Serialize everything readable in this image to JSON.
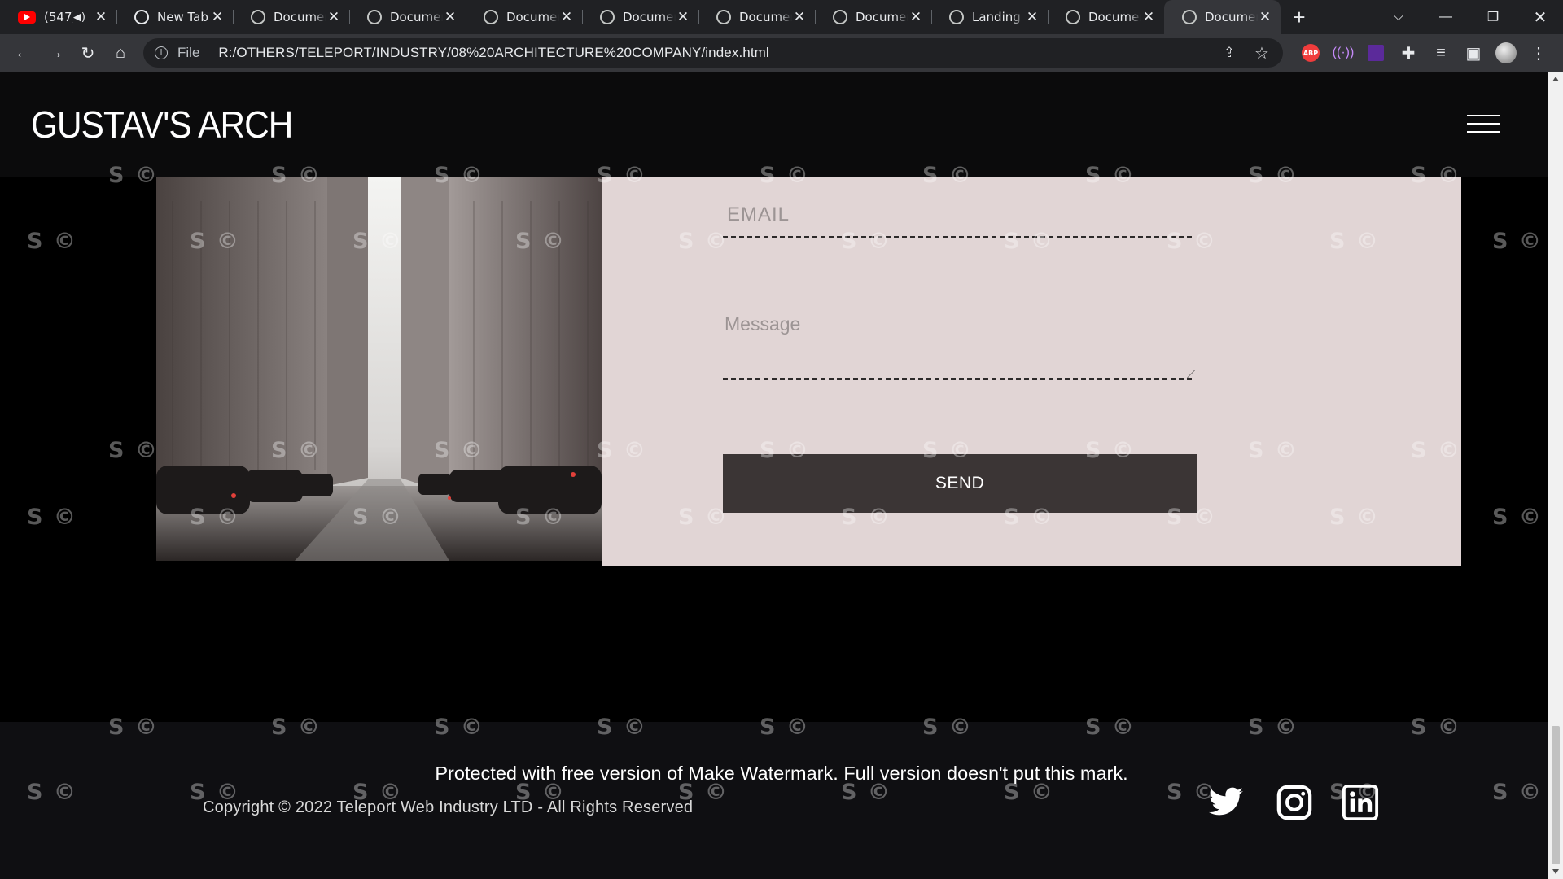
{
  "browser": {
    "tabs": [
      {
        "title": "(547)",
        "icon": "youtube-icon",
        "audio": true
      },
      {
        "title": "New Tab",
        "icon": "chrome-icon"
      },
      {
        "title": "Document",
        "icon": "globe-icon"
      },
      {
        "title": "Document",
        "icon": "globe-icon"
      },
      {
        "title": "Document",
        "icon": "globe-icon"
      },
      {
        "title": "Document",
        "icon": "globe-icon"
      },
      {
        "title": "Document",
        "icon": "globe-icon"
      },
      {
        "title": "Document",
        "icon": "globe-icon"
      },
      {
        "title": "Landing Page",
        "icon": "globe-icon"
      },
      {
        "title": "Document",
        "icon": "globe-icon"
      },
      {
        "title": "Document",
        "icon": "globe-icon",
        "active": true
      }
    ],
    "address": {
      "scheme_label": "File",
      "url": "R:/OTHERS/TELEPORT/INDUSTRY/08%20ARCHITECTURE%20COMPANY/index.html"
    },
    "extensions": {
      "abp_label": "ABP"
    }
  },
  "site": {
    "logo": "GUSTAV'S ARCH",
    "form": {
      "email_placeholder": "EMAIL",
      "message_placeholder": "Message",
      "send_label": "SEND"
    },
    "footer": {
      "copyright": "Copyright © 2022 Teleport Web Industry LTD - All Rights Reserved",
      "social": [
        "twitter-icon",
        "instagram-icon",
        "linkedin-icon"
      ]
    },
    "watermark": {
      "mark": "S ©",
      "notice": "Protected with free version of Make Watermark. Full version doesn't put this mark."
    }
  },
  "colors": {
    "form_bg": "#e1d5d5",
    "send_bg": "#3b3535",
    "header_bg": "#0b0b0c",
    "footer_bg": "#0f0f12"
  }
}
